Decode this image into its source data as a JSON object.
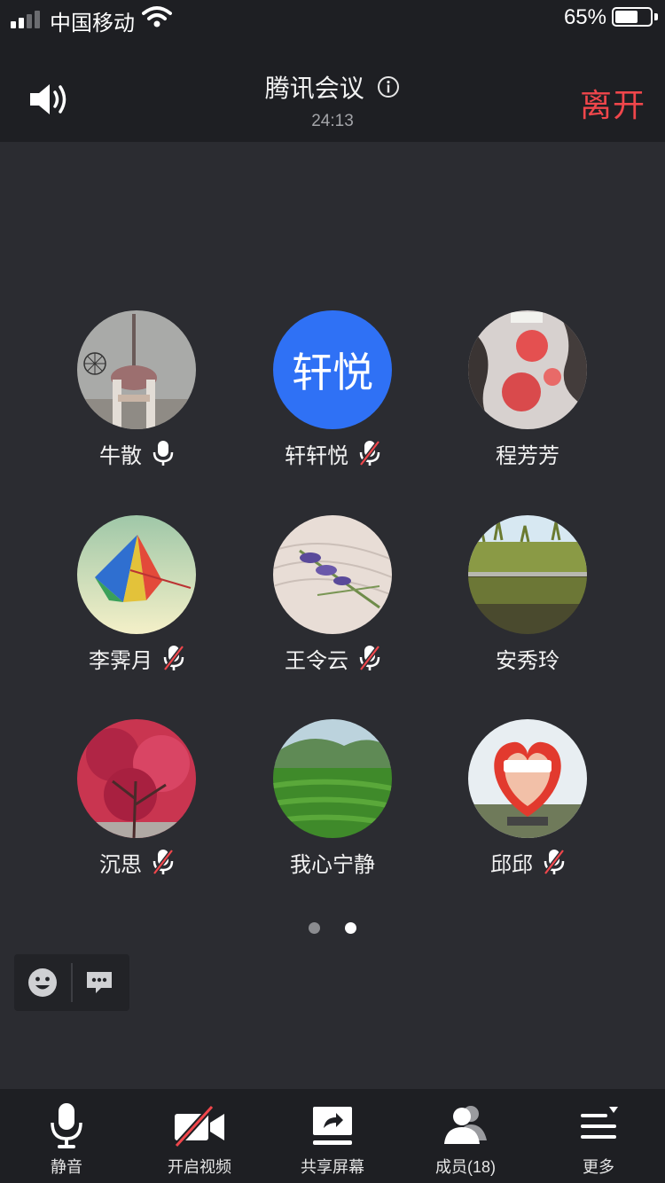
{
  "status_bar": {
    "carrier": "中国移动",
    "battery_percent": "65%",
    "battery_level": 0.65
  },
  "header": {
    "title": "腾讯会议",
    "timer": "24:13",
    "leave_label": "离开"
  },
  "participants": [
    {
      "name": "牛散",
      "mic": "on",
      "avatar": "tower-photo"
    },
    {
      "name": "轩轩悦",
      "mic": "muted",
      "avatar_text": "轩悦",
      "avatar_color": "#2f71f5"
    },
    {
      "name": "程芳芳",
      "mic": "none",
      "avatar": "fabric-photo"
    },
    {
      "name": "李霁月",
      "mic": "muted",
      "avatar": "umbrella-photo"
    },
    {
      "name": "王令云",
      "mic": "muted",
      "avatar": "lavender-photo"
    },
    {
      "name": "安秀玲",
      "mic": "none",
      "avatar": "lake-photo"
    },
    {
      "name": "沉思",
      "mic": "muted",
      "avatar": "red-tree-photo"
    },
    {
      "name": "我心宁静",
      "mic": "none",
      "avatar": "tea-field-photo"
    },
    {
      "name": "邱邱",
      "mic": "muted",
      "avatar": "sculpture-photo"
    }
  ],
  "pager": {
    "pages": 2,
    "active": 2
  },
  "toolbar": {
    "mute_label": "静音",
    "video_label": "开启视频",
    "share_label": "共享屏幕",
    "members_label": "成员(18)",
    "more_label": "更多"
  },
  "colors": {
    "accent": "#2f71f5",
    "leave": "#f0464b",
    "background": "#2b2c31",
    "bar": "#1e1f23"
  }
}
